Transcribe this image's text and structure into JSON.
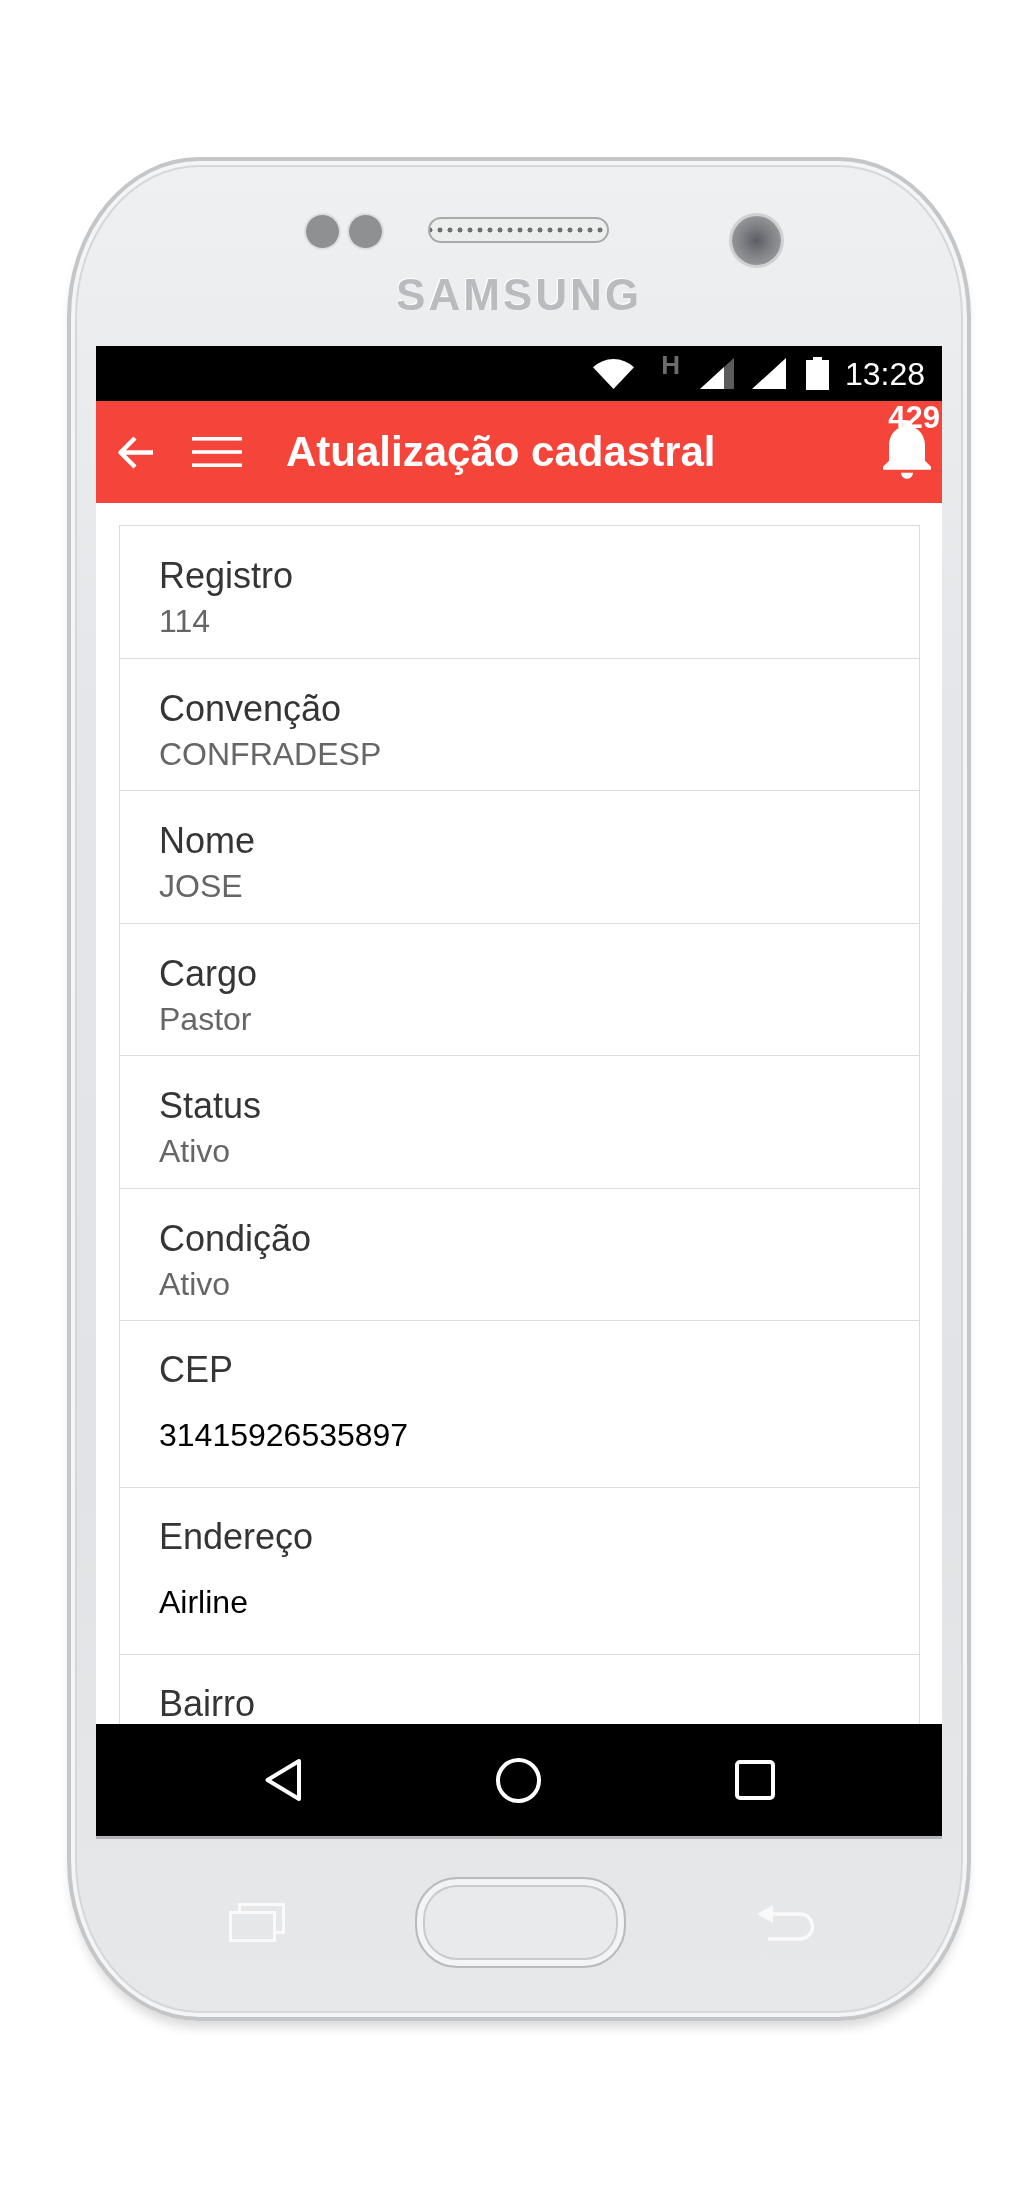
{
  "device": {
    "brand_label": "SAMSUNG"
  },
  "status_bar": {
    "network_type": "H",
    "time": "13:28"
  },
  "app_bar": {
    "title": "Atualização cadastral",
    "notification_count": "429"
  },
  "fields": [
    {
      "kind": "readonly",
      "label": "Registro",
      "value": "114"
    },
    {
      "kind": "readonly",
      "label": "Convenção",
      "value": "CONFRADESP"
    },
    {
      "kind": "readonly",
      "label": "Nome",
      "value": "JOSE"
    },
    {
      "kind": "readonly",
      "label": "Cargo",
      "value": "Pastor"
    },
    {
      "kind": "readonly",
      "label": "Status",
      "value": "Ativo"
    },
    {
      "kind": "readonly",
      "label": "Condição",
      "value": "Ativo"
    },
    {
      "kind": "input",
      "label": "CEP",
      "value": "31415926535897"
    },
    {
      "kind": "input",
      "label": "Endereço",
      "value": "Airline"
    },
    {
      "kind": "input",
      "label": "Bairro"
    }
  ]
}
